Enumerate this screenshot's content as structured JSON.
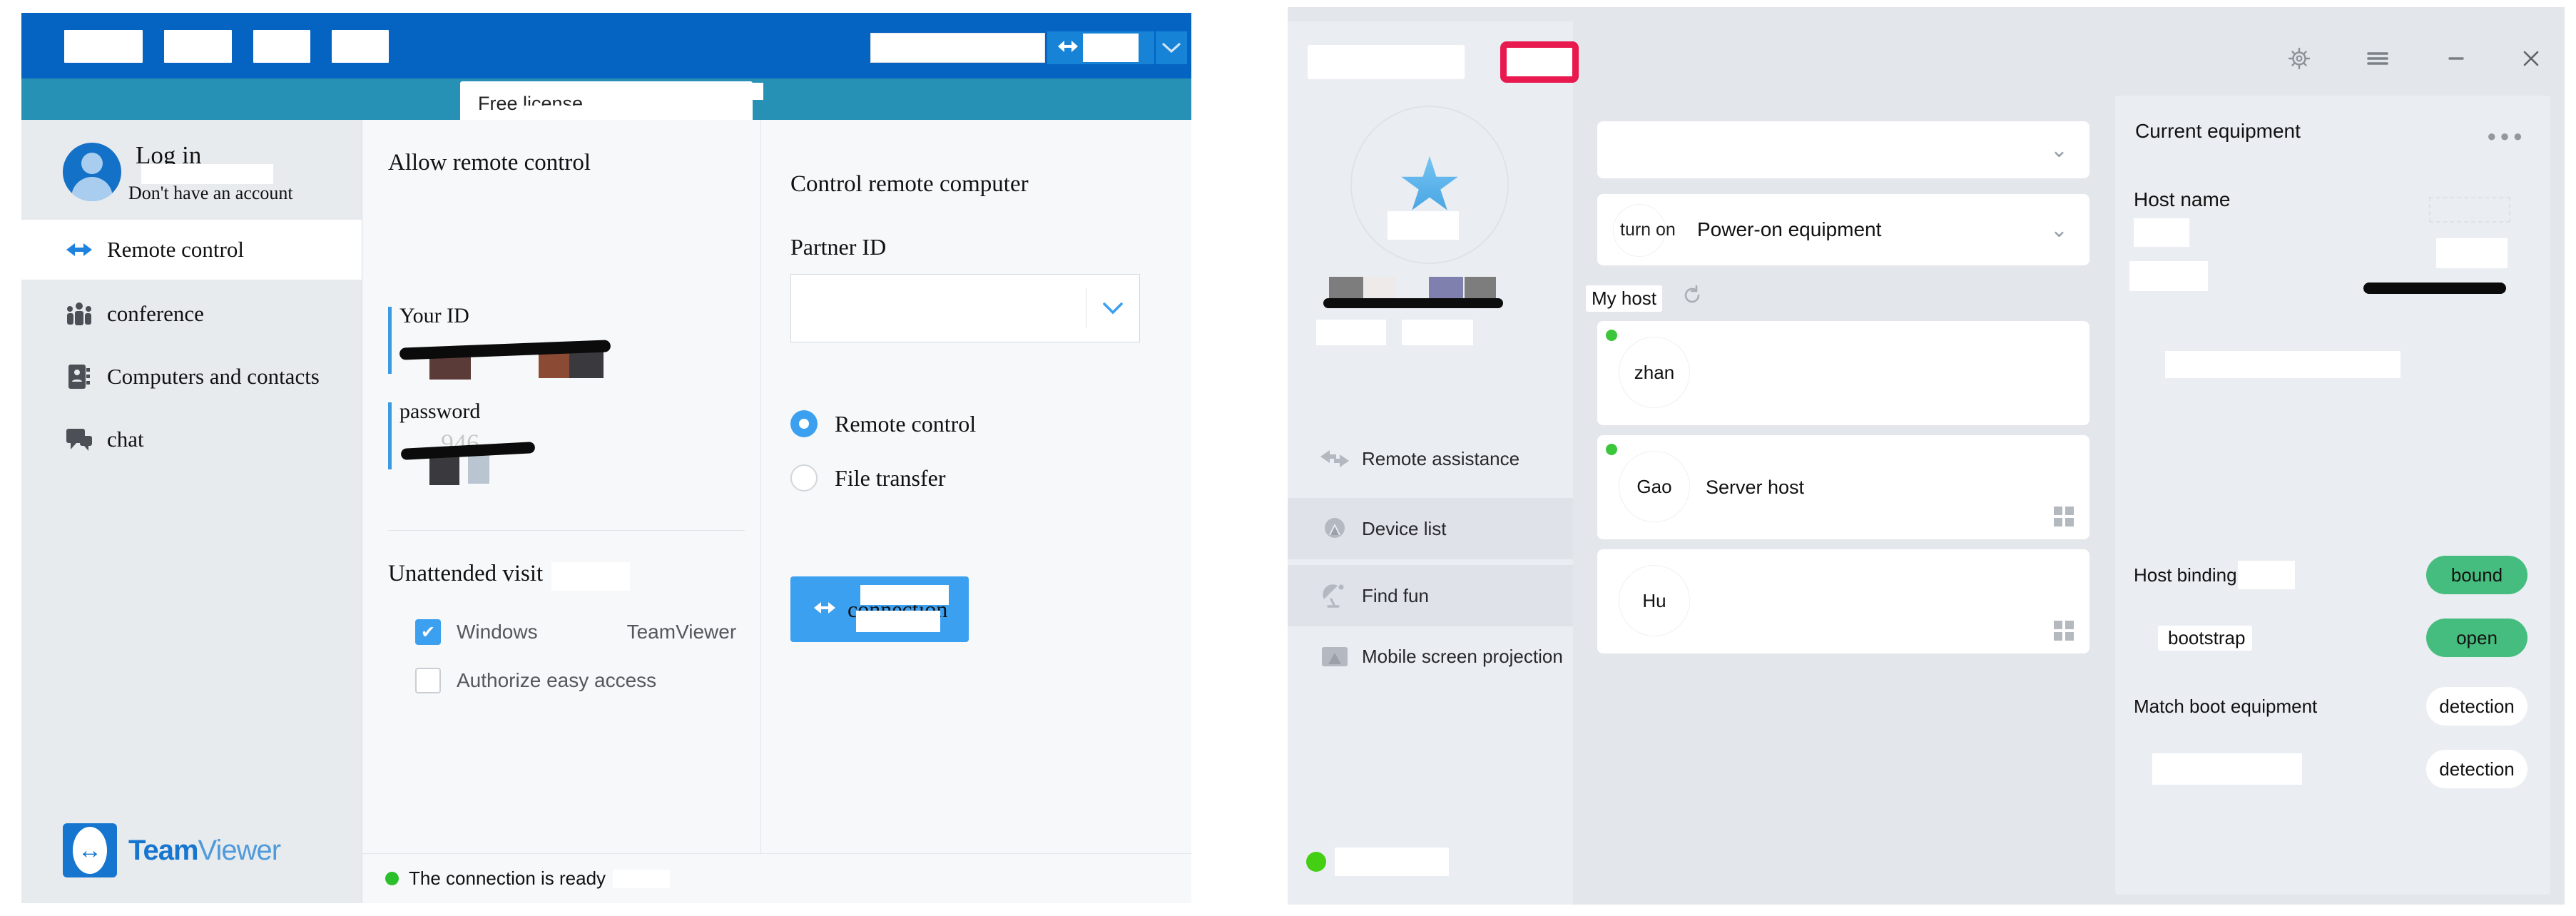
{
  "teamviewer": {
    "titlebar": {
      "menus": [
        "",
        "",
        "",
        ""
      ],
      "search_value": "",
      "search_button_label": "",
      "arrows_icon": "remote-control-arrows-icon",
      "chevron_icon": "chevron-down-icon"
    },
    "tab": {
      "label": "Free license"
    },
    "account": {
      "login_label": "Log in",
      "no_account_label": "Don't have an account"
    },
    "nav": [
      {
        "label": "Remote control",
        "icon": "remote-control-arrows-icon",
        "active": true
      },
      {
        "label": "conference",
        "icon": "group-people-icon",
        "active": false
      },
      {
        "label": "Computers and contacts",
        "icon": "address-book-icon",
        "active": false
      },
      {
        "label": "chat",
        "icon": "chat-bubble-icon",
        "active": false
      }
    ],
    "logo": {
      "bold": "Team",
      "light": "Viewer"
    },
    "allow_section": {
      "heading": "Allow remote control",
      "your_id_label": "Your ID",
      "your_id_value": "",
      "password_label": "password",
      "password_value": ""
    },
    "unattended": {
      "heading": "Unattended visit",
      "checkbox_windows": {
        "label_a": "Windows",
        "label_b": "TeamViewer",
        "checked": true
      },
      "checkbox_easy_access": {
        "label": "Authorize easy access",
        "checked": false
      }
    },
    "control_section": {
      "heading": "Control remote computer",
      "partner_id_label": "Partner ID",
      "partner_id_value": "",
      "partner_id_placeholder": "",
      "radio_remote_control": {
        "label": "Remote control",
        "selected": true
      },
      "radio_file_transfer": {
        "label": "File transfer",
        "selected": false
      },
      "connect_button_label": "connection"
    },
    "statusbar": {
      "text": "The connection is ready",
      "dot_color": "#2cbf2c"
    }
  },
  "devicemanager": {
    "topbar": {
      "brand_label": "",
      "badge_color": "#e8194e",
      "gear_icon": "gear-icon",
      "menu_icon": "hamburger-menu-icon",
      "minimize_icon": "minimize-icon",
      "close_icon": "close-icon"
    },
    "sidebar": {
      "star_icon": "star-icon",
      "user_name": "",
      "nav": [
        {
          "label": "Remote assistance",
          "icon": "remote-assistance-arrows-icon",
          "active": false
        },
        {
          "label": "Device list",
          "icon": "device-list-icon",
          "active": true
        },
        {
          "label": "Find fun",
          "icon": "satellite-dish-icon",
          "active": true
        },
        {
          "label": "Mobile screen projection",
          "icon": "screen-cast-icon",
          "active": false
        }
      ],
      "footer_status": "",
      "footer_dot_color": "#44cf15"
    },
    "middle": {
      "group_select_value": "",
      "power_select": {
        "circle_label": "turn on",
        "value": "Power-on equipment"
      },
      "my_host_label": "My host",
      "refresh_icon": "refresh-icon",
      "cards": [
        {
          "avatar": "zhan",
          "name": "",
          "online": true,
          "os_icon": "windows-icon",
          "show_os": false
        },
        {
          "avatar": "Gao",
          "name": "Server host",
          "online": true,
          "os_icon": "windows-icon",
          "show_os": true
        },
        {
          "avatar": "Hu",
          "name": "",
          "online": false,
          "os_icon": "windows-icon",
          "show_os": true
        }
      ]
    },
    "detail": {
      "title": "Current equipment",
      "more_icon": "more-dots-icon",
      "hostname_label": "Host name",
      "rows": [
        {
          "label": "Host binding",
          "pill": "bound",
          "pill_style": "green"
        },
        {
          "label": "bootstrap",
          "pill": "open",
          "pill_style": "green"
        },
        {
          "label": "Match boot equipment",
          "pill": "detection",
          "pill_style": "white"
        },
        {
          "label": "",
          "pill": "detection",
          "pill_style": "white"
        }
      ]
    }
  }
}
